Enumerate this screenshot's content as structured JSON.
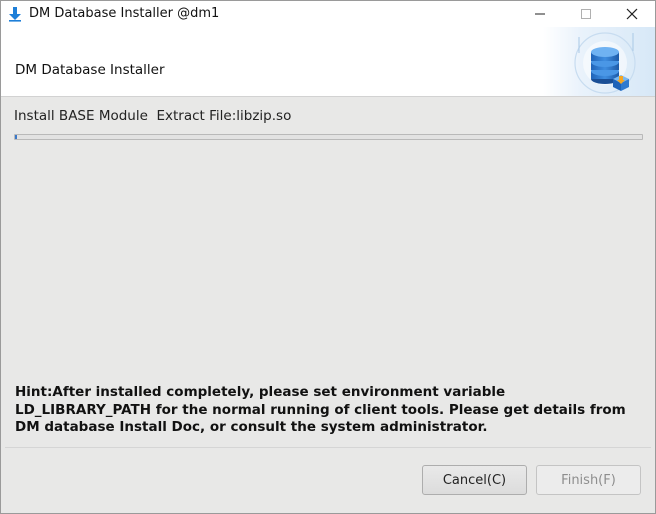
{
  "window": {
    "title": "DM Database Installer @dm1"
  },
  "banner": {
    "title": "DM Database Installer",
    "art_icon": "database-install-icon"
  },
  "status": {
    "text": "Install BASE Module  Extract File:libzip.so"
  },
  "progress": {
    "fraction": 0.003,
    "color": "#3b78c8"
  },
  "hint": {
    "text": "Hint:After installed completely, please set environment variable LD_LIBRARY_PATH for the normal running of client tools. Please get details from DM database Install Doc, or consult the system administrator."
  },
  "buttons": {
    "cancel": "Cancel(C)",
    "finish": "Finish(F)"
  },
  "colors": {
    "accent": "#1e7fd8",
    "window_bg": "#e8e8e7"
  }
}
